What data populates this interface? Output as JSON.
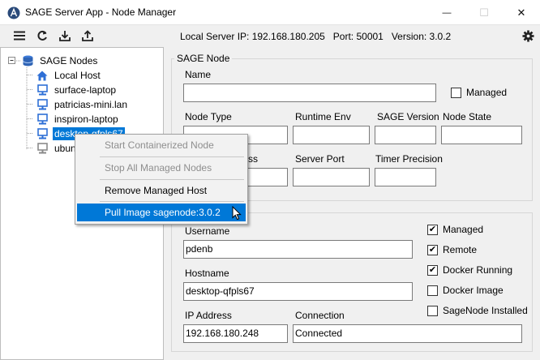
{
  "window": {
    "title": "SAGE Server App - Node Manager",
    "minimize_glyph": "—",
    "maximize_glyph": "☐",
    "close_glyph": "✕"
  },
  "toolbar": {
    "icons": [
      "menu-icon",
      "refresh-icon",
      "download-icon",
      "upload-icon",
      "gear-icon"
    ],
    "status_text": "Local Server IP: 192.168.180.205   Port: 50001   Version: 3.0.2"
  },
  "tree": {
    "root_label": "SAGE Nodes",
    "items": [
      {
        "label": "Local Host",
        "icon": "home-icon"
      },
      {
        "label": "surface-laptop",
        "icon": "computer-icon"
      },
      {
        "label": "patricias-mini.lan",
        "icon": "computer-icon"
      },
      {
        "label": "inspiron-laptop",
        "icon": "computer-icon"
      },
      {
        "label": "desktop-qfpls67",
        "icon": "computer-icon",
        "selected": true
      },
      {
        "label": "ubun",
        "icon": "computer-icon"
      }
    ]
  },
  "node_panel": {
    "group_title": "SAGE Node",
    "name_label": "Name",
    "name_value": "",
    "managed_label": "Managed",
    "managed_checked": false,
    "node_type_label": "Node Type",
    "runtime_env_label": "Runtime Env",
    "sage_version_label": "SAGE Version",
    "node_state_label": "Node State",
    "ip_address_partial_label": "ss",
    "server_port_label": "Server Port",
    "timer_precision_label": "Timer Precision"
  },
  "host_panel": {
    "username_label": "Username",
    "username_value": "pdenb",
    "hostname_label": "Hostname",
    "hostname_value": "desktop-qfpls67",
    "ip_label": "IP Address",
    "ip_value": "192.168.180.248",
    "connection_label": "Connection",
    "connection_value": "Connected",
    "checks": [
      {
        "label": "Managed",
        "checked": true
      },
      {
        "label": "Remote",
        "checked": true
      },
      {
        "label": "Docker Running",
        "checked": true
      },
      {
        "label": "Docker Image",
        "checked": false
      },
      {
        "label": "SageNode Installed",
        "checked": false
      }
    ]
  },
  "context_menu": {
    "items": [
      {
        "label": "Start Containerized Node",
        "enabled": false
      },
      {
        "label": "Stop All Managed Nodes",
        "enabled": false
      },
      {
        "label": "Remove Managed Host",
        "enabled": true
      },
      {
        "label": "Pull Image sagenode:3.0.2",
        "enabled": true,
        "hover": true
      }
    ]
  }
}
